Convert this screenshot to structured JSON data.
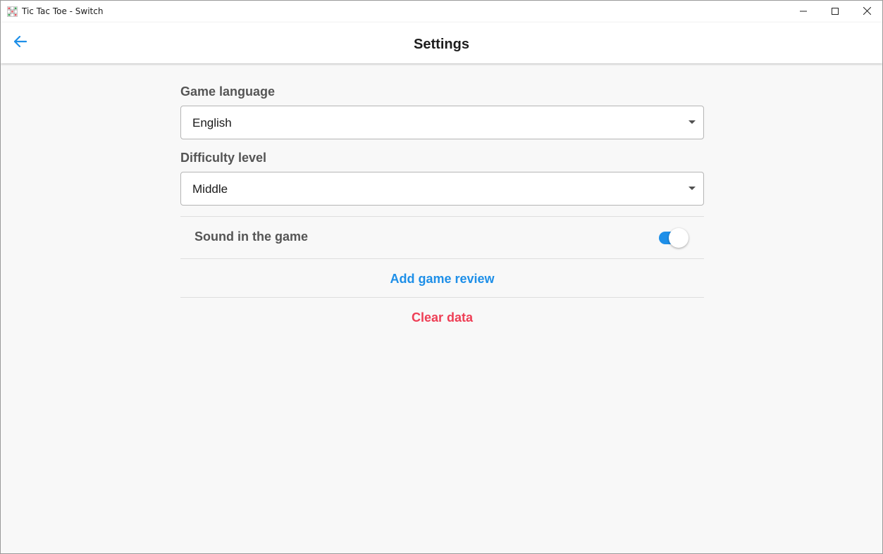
{
  "window": {
    "title": "Tic Tac Toe - Switch",
    "icons": {
      "app": "tic-tac-toe-grid-icon",
      "minimize": "minimize-icon",
      "maximize": "maximize-icon",
      "close": "close-icon"
    }
  },
  "appbar": {
    "title": "Settings",
    "back_icon": "arrow-left-icon"
  },
  "settings": {
    "language": {
      "label": "Game language",
      "value": "English",
      "icon": "dropdown-arrow-icon"
    },
    "difficulty": {
      "label": "Difficulty level",
      "value": "Middle",
      "icon": "dropdown-arrow-icon"
    },
    "sound": {
      "label": "Sound in the game",
      "enabled": true
    },
    "review_label": "Add game review",
    "clear_label": "Clear data"
  },
  "colors": {
    "accent": "#1e8fe8",
    "danger": "#ee3e55",
    "label_gray": "#555555"
  }
}
